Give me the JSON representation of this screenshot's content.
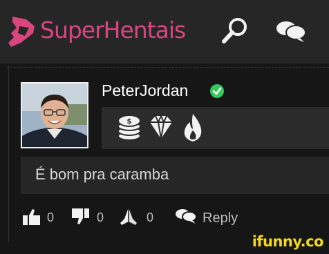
{
  "header": {
    "logo_text": "SuperHentais",
    "search_icon": "magnifier-icon",
    "chat_icon": "speech-bubbles-icon"
  },
  "comment": {
    "username": "PeterJordan",
    "verified_icon": "check-circle-icon",
    "badges": [
      "coins-stack-icon",
      "diamond-icon",
      "flame-icon"
    ],
    "text": "É bom pra caramba",
    "likes": "0",
    "dislikes": "0",
    "prays": "0",
    "reply_label": "Reply"
  },
  "watermark": "ifunny.co",
  "colors": {
    "brand": "#d9467e",
    "verified": "#35c85a",
    "background": "#161616",
    "watermark": "#f5d91d"
  }
}
